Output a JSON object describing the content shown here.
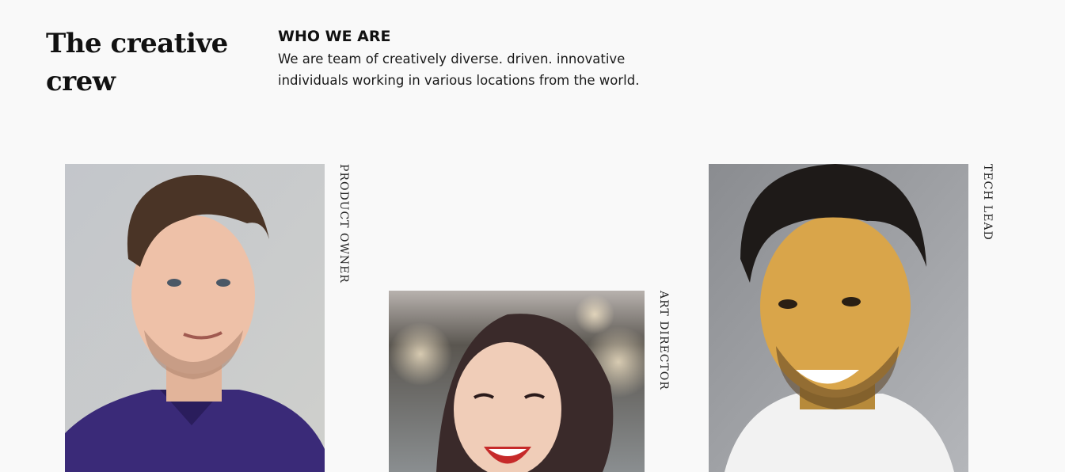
{
  "header": {
    "title": "The creative crew",
    "subtitle": "WHO WE ARE",
    "description": "We are team of creatively diverse. driven. innovative individuals working in various locations from the world."
  },
  "team": [
    {
      "role": "PRODUCT OWNER",
      "photo_icon": "man-portrait-photo"
    },
    {
      "role": "ART DIRECTOR",
      "photo_icon": "woman-portrait-photo"
    },
    {
      "role": "TECH LEAD",
      "photo_icon": "man-portrait-photo"
    }
  ],
  "colors": {
    "background": "#f9f9f9",
    "text": "#111111"
  }
}
